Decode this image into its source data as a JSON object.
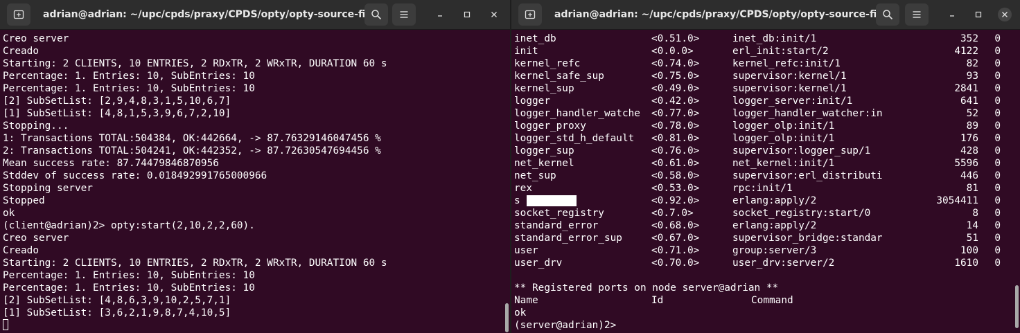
{
  "left_window": {
    "title": "adrian@adrian: ~/upc/cpds/praxy/CPDS/opty/opty-source-fil...",
    "lines": [
      "Creo server",
      "Creado",
      "Starting: 2 CLIENTS, 10 ENTRIES, 2 RDxTR, 2 WRxTR, DURATION 60 s",
      "Percentage: 1. Entries: 10, SubEntries: 10",
      "Percentage: 1. Entries: 10, SubEntries: 10",
      "[2] SubSetList: [2,9,4,8,3,1,5,10,6,7]",
      "[1] SubSetList: [4,8,1,5,3,9,6,7,2,10]",
      "Stopping...",
      "1: Transactions TOTAL:504384, OK:442664, -> 87.76329146047456 %",
      "2: Transactions TOTAL:504241, OK:442352, -> 87.72630547694456 %",
      "Mean success rate: 87.74479846870956",
      "Stddev of success rate: 0.018492991765000966",
      "Stopping server",
      "Stopped",
      "ok",
      "(client@adrian)2> opty:start(2,10,2,2,60).",
      "Creo server",
      "Creado",
      "Starting: 2 CLIENTS, 10 ENTRIES, 2 RDxTR, 2 WRxTR, DURATION 60 s",
      "Percentage: 1. Entries: 10, SubEntries: 10",
      "Percentage: 1. Entries: 10, SubEntries: 10",
      "[2] SubSetList: [4,8,6,3,9,10,2,5,7,1]",
      "[1] SubSetList: [3,6,2,1,9,8,7,4,10,5]"
    ]
  },
  "right_window": {
    "title": "adrian@adrian: ~/upc/cpds/praxy/CPDS/opty/opty-source-fil...",
    "processes": [
      {
        "name": "inet_db",
        "pid": "<0.51.0>",
        "init": "inet_db:init/1",
        "reds": "352",
        "msgs": "0"
      },
      {
        "name": "init",
        "pid": "<0.0.0>",
        "init": "erl_init:start/2",
        "reds": "4122",
        "msgs": "0"
      },
      {
        "name": "kernel_refc",
        "pid": "<0.74.0>",
        "init": "kernel_refc:init/1",
        "reds": "82",
        "msgs": "0"
      },
      {
        "name": "kernel_safe_sup",
        "pid": "<0.75.0>",
        "init": "supervisor:kernel/1",
        "reds": "93",
        "msgs": "0"
      },
      {
        "name": "kernel_sup",
        "pid": "<0.49.0>",
        "init": "supervisor:kernel/1",
        "reds": "2841",
        "msgs": "0"
      },
      {
        "name": "logger",
        "pid": "<0.42.0>",
        "init": "logger_server:init/1",
        "reds": "641",
        "msgs": "0"
      },
      {
        "name": "logger_handler_watche",
        "pid": "<0.77.0>",
        "init": "logger_handler_watcher:in",
        "reds": "52",
        "msgs": "0"
      },
      {
        "name": "logger_proxy",
        "pid": "<0.78.0>",
        "init": "logger_olp:init/1",
        "reds": "89",
        "msgs": "0"
      },
      {
        "name": "logger_std_h_default",
        "pid": "<0.81.0>",
        "init": "logger_olp:init/1",
        "reds": "176",
        "msgs": "0"
      },
      {
        "name": "logger_sup",
        "pid": "<0.76.0>",
        "init": "supervisor:logger_sup/1",
        "reds": "428",
        "msgs": "0"
      },
      {
        "name": "net_kernel",
        "pid": "<0.61.0>",
        "init": "net_kernel:init/1",
        "reds": "5596",
        "msgs": "0"
      },
      {
        "name": "net_sup",
        "pid": "<0.58.0>",
        "init": "supervisor:erl_distributi",
        "reds": "446",
        "msgs": "0"
      },
      {
        "name": "rex",
        "pid": "<0.53.0>",
        "init": "rpc:init/1",
        "reds": "81",
        "msgs": "0"
      },
      {
        "name": "s",
        "pid": "<0.92.0>",
        "init": "erlang:apply/2",
        "reds": "3054411",
        "msgs": "0",
        "redacted": true
      },
      {
        "name": "socket_registry",
        "pid": "<0.7.0>",
        "init": "socket_registry:start/0",
        "reds": "8",
        "msgs": "0"
      },
      {
        "name": "standard_error",
        "pid": "<0.68.0>",
        "init": "erlang:apply/2",
        "reds": "14",
        "msgs": "0"
      },
      {
        "name": "standard_error_sup",
        "pid": "<0.67.0>",
        "init": "supervisor_bridge:standar",
        "reds": "51",
        "msgs": "0"
      },
      {
        "name": "user",
        "pid": "<0.71.0>",
        "init": "group:server/3",
        "reds": "100",
        "msgs": "0"
      },
      {
        "name": "user_drv",
        "pid": "<0.70.0>",
        "init": "user_drv:server/2",
        "reds": "1610",
        "msgs": "0"
      }
    ],
    "ports_heading": "** Registered ports on node server@adrian **",
    "ports_columns": {
      "name": "Name",
      "id": "Id",
      "command": "Command"
    },
    "after_lines": [
      "ok",
      "(server@adrian)2>"
    ]
  }
}
